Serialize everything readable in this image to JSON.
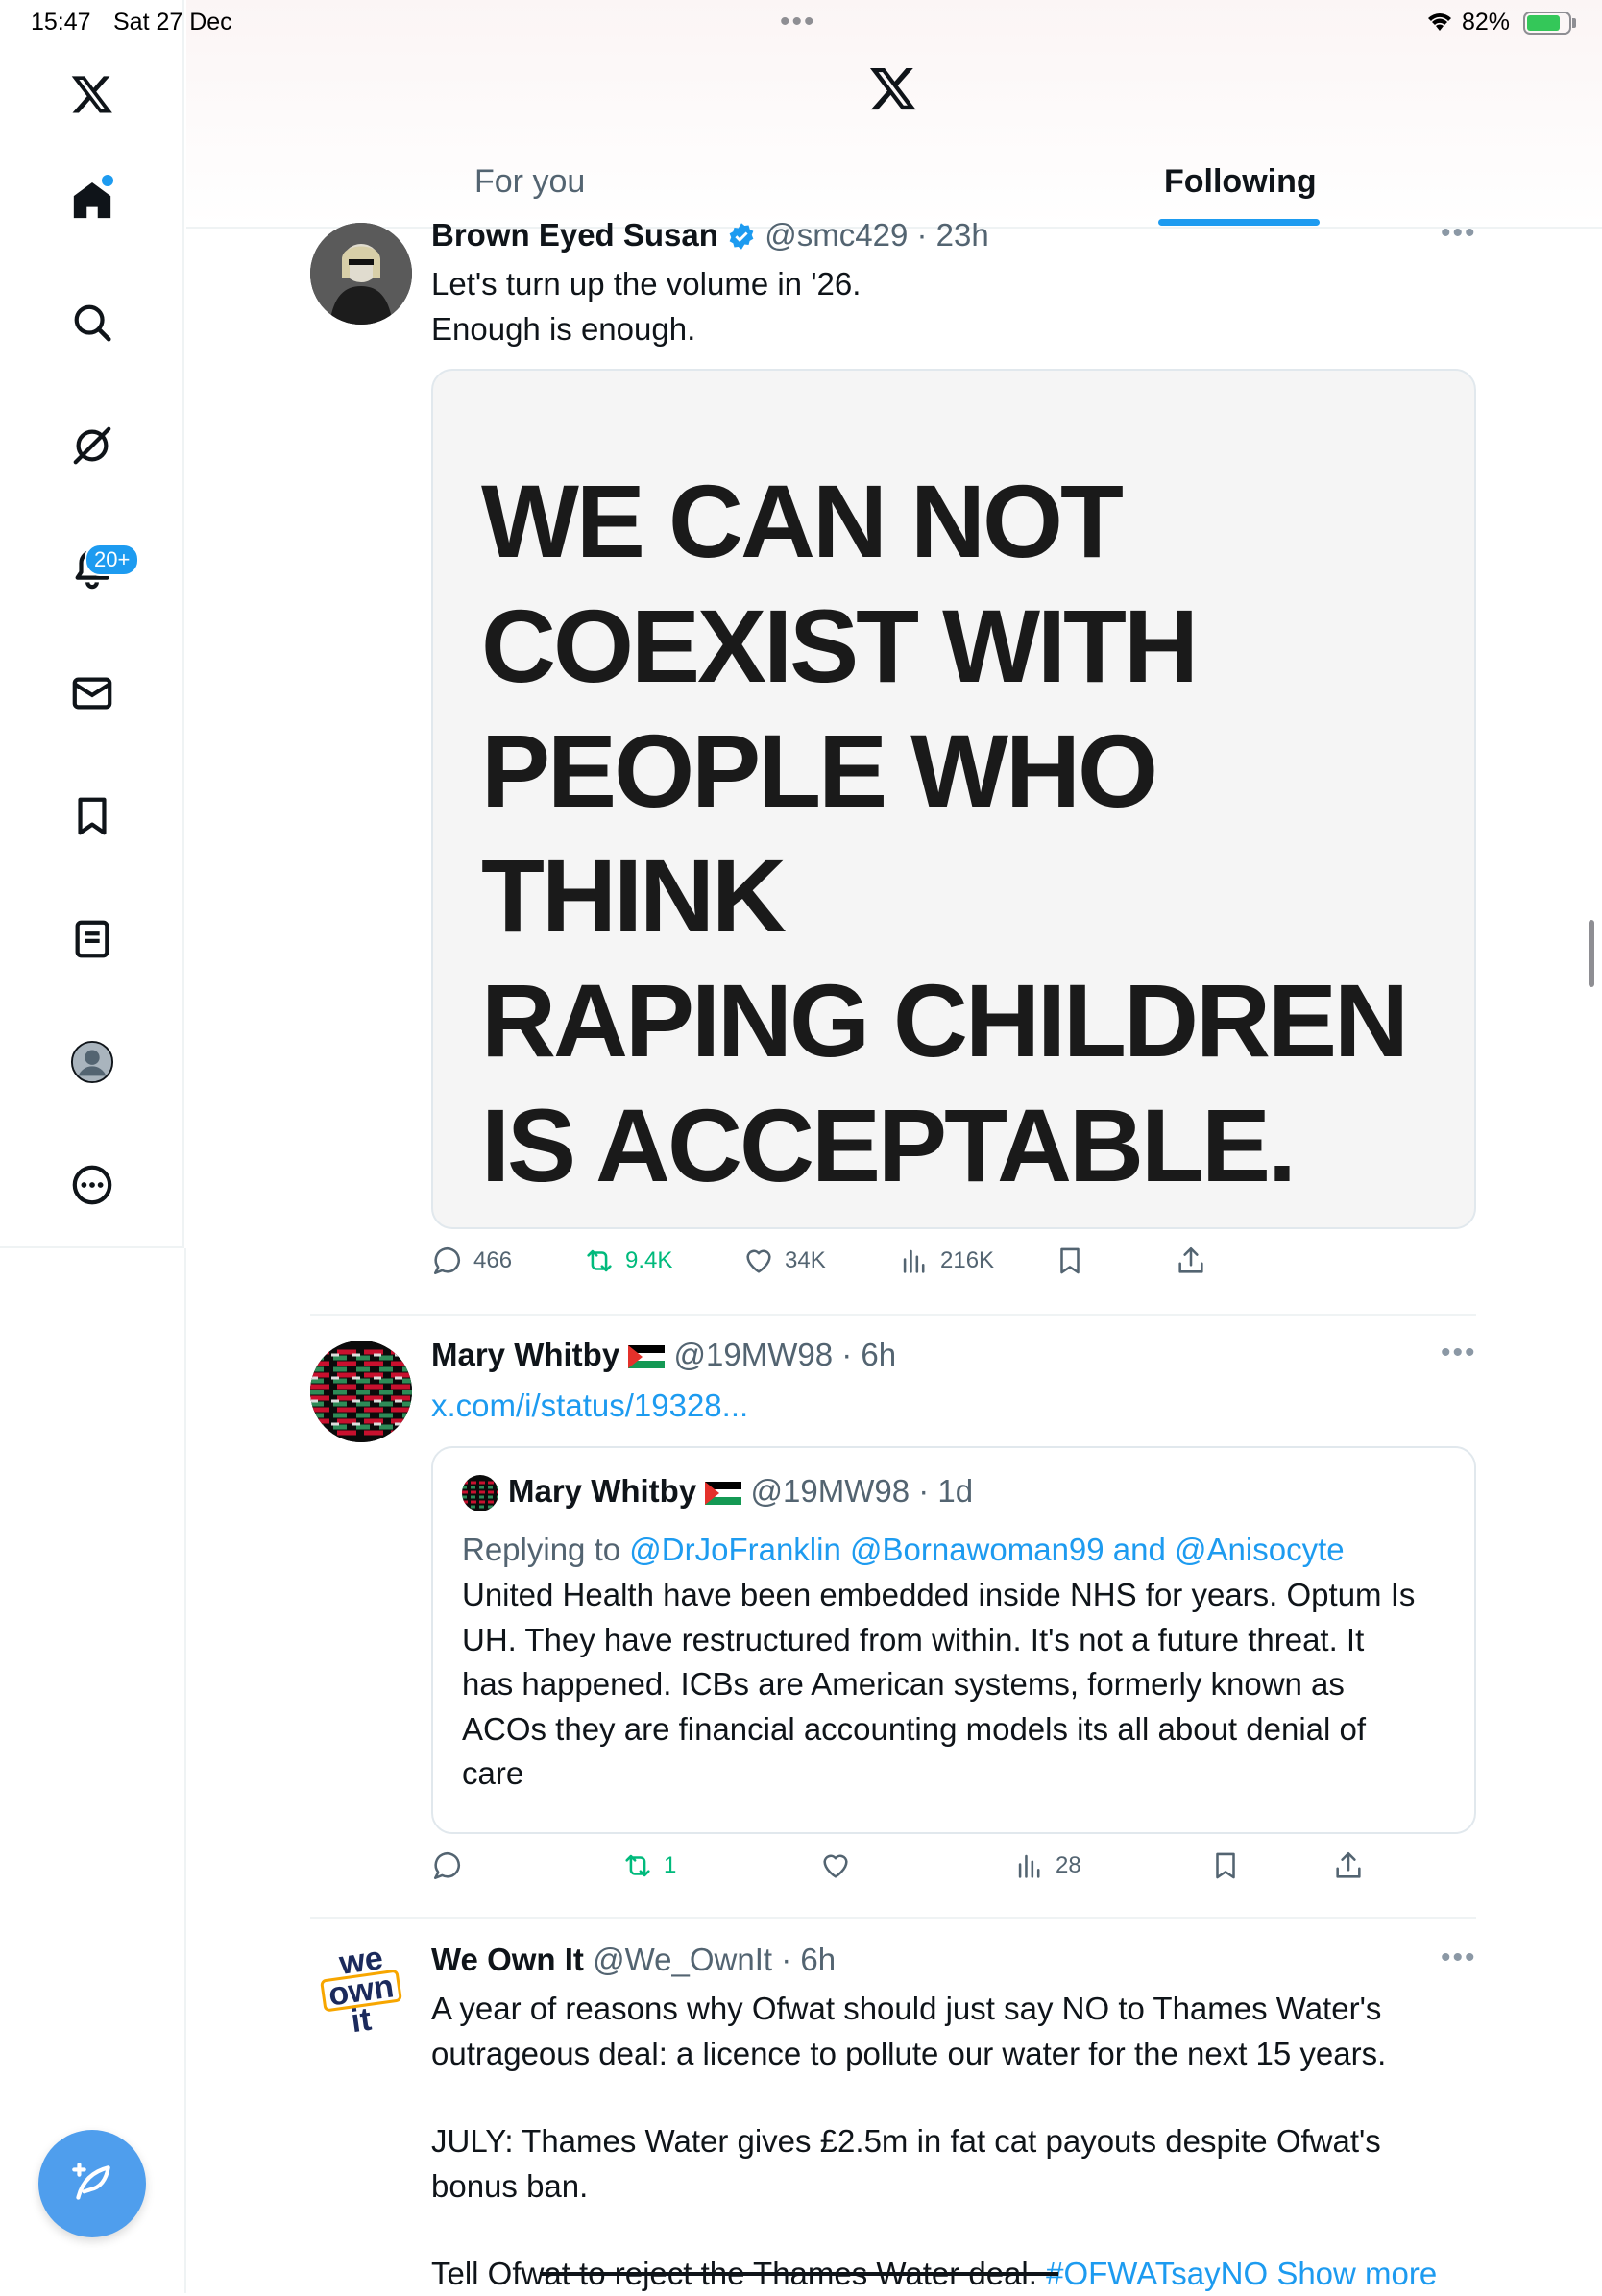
{
  "status_bar": {
    "time": "15:47",
    "date": "Sat 27 Dec",
    "battery": "82%"
  },
  "sidebar": {
    "notifications_badge": "20+"
  },
  "header": {
    "tabs": [
      {
        "label": "For you"
      },
      {
        "label": "Following"
      }
    ]
  },
  "tweets": [
    {
      "name": "Brown Eyed Susan",
      "handle": "@smc429",
      "time": "23h",
      "text_lines": [
        "Let's turn up the volume in '26.",
        "Enough is enough."
      ],
      "image_text": [
        "WE CAN NOT",
        "COEXIST WITH",
        "PEOPLE WHO",
        "THINK",
        "RAPING CHILDREN",
        "IS ACCEPTABLE."
      ],
      "stats": {
        "replies": "466",
        "reposts": "9.4K",
        "likes": "34K",
        "views": "216K"
      }
    },
    {
      "name": "Mary Whitby",
      "handle": "@19MW98",
      "time": "6h",
      "link": "x.com/i/status/19328...",
      "quote": {
        "name": "Mary Whitby",
        "handle": "@19MW98",
        "time": "1d",
        "replying_prefix": "Replying to",
        "replying_users": "@DrJoFranklin @Bornawoman99 and @Anisocyte",
        "text_lines": [
          "United Health have been embedded inside NHS for years. Optum Is",
          "UH. They have restructured from within. It's not a future threat. It",
          "has happened. ICBs are American systems, formerly known as",
          "ACOs they are financial accounting models its all about denial of",
          "care"
        ]
      },
      "stats": {
        "reposts": "1",
        "views": "28"
      }
    },
    {
      "name": "We Own It",
      "handle": "@We_OwnIt",
      "time": "6h",
      "avatar_text": [
        "we",
        "own",
        "it"
      ],
      "text_lines": [
        "A year of reasons why Ofwat should just say NO to Thames Water's",
        "outrageous deal: a licence to pollute our water for the next 15 years.",
        "",
        "JULY: Thames Water gives £2.5m in fat cat payouts despite Ofwat's",
        "bonus ban.",
        "",
        "Tell Ofwat to reject the Thames Water deal."
      ],
      "hashtag": "#OFWATsayNO",
      "show_more": "Show more"
    }
  ]
}
